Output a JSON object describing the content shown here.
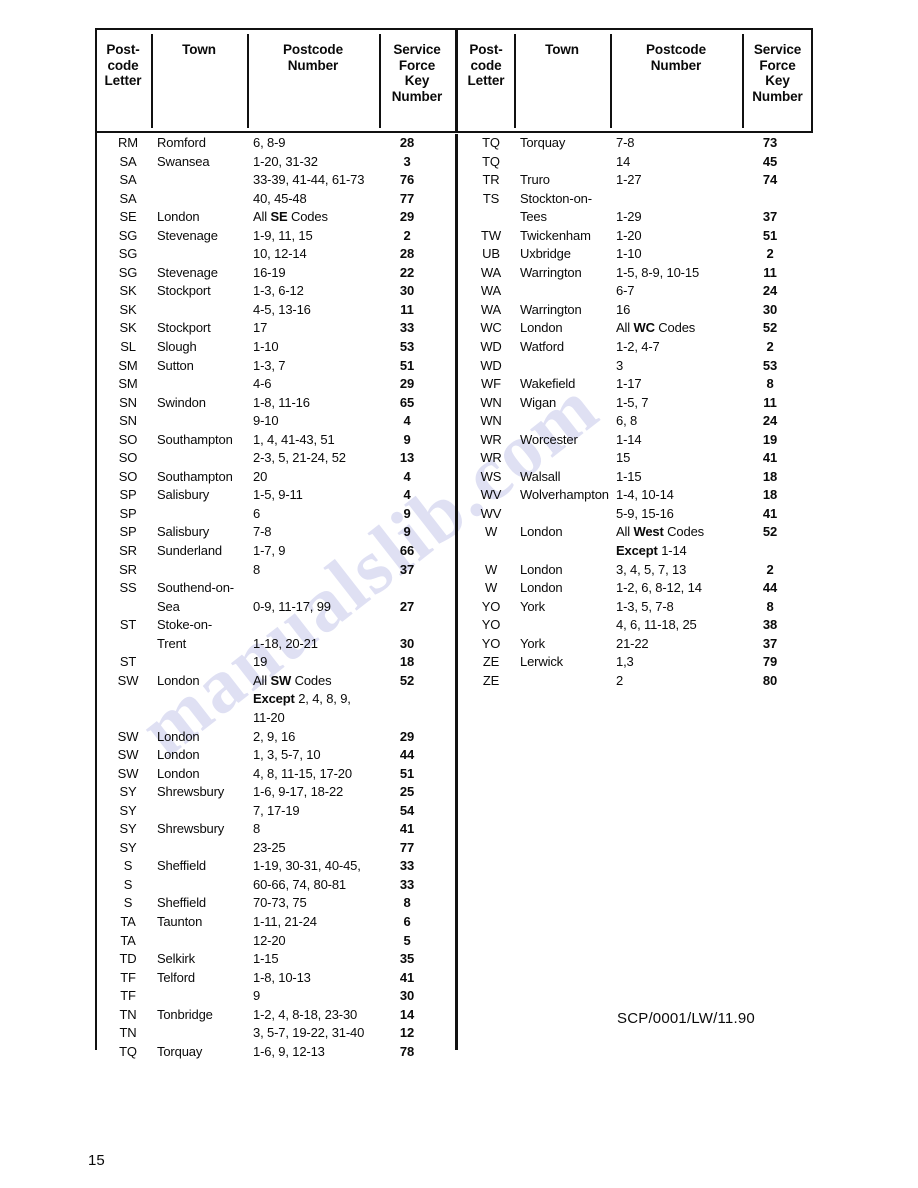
{
  "page": {
    "number": "15",
    "document_reference": "SCP/0001/LW/11.90",
    "watermark": "manualslib.com"
  },
  "table": {
    "headers": {
      "postcode_letter": [
        "Post-",
        "code",
        "Letter"
      ],
      "town": [
        "Town"
      ],
      "postcode_number": [
        "Postcode",
        "Number"
      ],
      "service_force_key_number": [
        "Service",
        "Force",
        "Key",
        "Number"
      ]
    },
    "left_column": [
      {
        "letter": "RM",
        "town": "Romford",
        "code": "6, 8-9",
        "key": "28"
      },
      {
        "letter": "SA",
        "town": "Swansea",
        "code": "1-20, 31-32",
        "key": "3"
      },
      {
        "letter": "SA",
        "town": "",
        "code": "33-39, 41-44, 61-73",
        "key": "76"
      },
      {
        "letter": "SA",
        "town": "",
        "code": "40, 45-48",
        "key": "77"
      },
      {
        "letter": "SE",
        "town": "London",
        "code": "All SE Codes",
        "code_bold": "SE",
        "key": "29"
      },
      {
        "letter": "SG",
        "town": "Stevenage",
        "code": "1-9, 11, 15",
        "key": "2"
      },
      {
        "letter": "SG",
        "town": "",
        "code": "10, 12-14",
        "key": "28"
      },
      {
        "letter": "SG",
        "town": "Stevenage",
        "code": "16-19",
        "key": "22"
      },
      {
        "letter": "SK",
        "town": "Stockport",
        "code": "1-3, 6-12",
        "key": "30"
      },
      {
        "letter": "SK",
        "town": "",
        "code": "4-5, 13-16",
        "key": "11"
      },
      {
        "letter": "SK",
        "town": "Stockport",
        "code": "17",
        "key": "33"
      },
      {
        "letter": "SL",
        "town": "Slough",
        "code": "1-10",
        "key": "53"
      },
      {
        "letter": "SM",
        "town": "Sutton",
        "code": "1-3, 7",
        "key": "51"
      },
      {
        "letter": "SM",
        "town": "",
        "code": "4-6",
        "key": "29"
      },
      {
        "letter": "SN",
        "town": "Swindon",
        "code": "1-8, 11-16",
        "key": "65"
      },
      {
        "letter": "SN",
        "town": "",
        "code": "9-10",
        "key": "4"
      },
      {
        "letter": "SO",
        "town": "Southampton",
        "code": "1, 4, 41-43, 51",
        "key": "9"
      },
      {
        "letter": "SO",
        "town": "",
        "code": "2-3, 5, 21-24, 52",
        "key": "13"
      },
      {
        "letter": "SO",
        "town": "Southampton",
        "code": "20",
        "key": "4"
      },
      {
        "letter": "SP",
        "town": "Salisbury",
        "code": "1-5, 9-11",
        "key": "4"
      },
      {
        "letter": "SP",
        "town": "",
        "code": "6",
        "key": "9"
      },
      {
        "letter": "SP",
        "town": "Salisbury",
        "code": "7-8",
        "key": "9"
      },
      {
        "letter": "SR",
        "town": "Sunderland",
        "code": "1-7, 9",
        "key": "66"
      },
      {
        "letter": "SR",
        "town": "",
        "code": "8",
        "key": "37"
      },
      {
        "letter": "SS",
        "town": "Southend-on-",
        "code": "",
        "key": ""
      },
      {
        "letter": "",
        "town": "Sea",
        "code": "0-9, 11-17, 99",
        "key": "27"
      },
      {
        "letter": "ST",
        "town": "Stoke-on-",
        "code": "",
        "key": ""
      },
      {
        "letter": "",
        "town": "Trent",
        "code": "1-18, 20-21",
        "key": "30"
      },
      {
        "letter": "ST",
        "town": "",
        "code": "19",
        "key": "18"
      },
      {
        "letter": "SW",
        "town": "London",
        "code": "All SW Codes",
        "code_bold": "SW",
        "key": "52"
      },
      {
        "letter": "",
        "town": "",
        "code": "Except 2, 4, 8, 9,",
        "code_bold": "Except",
        "key": ""
      },
      {
        "letter": "",
        "town": "",
        "code": "11-20",
        "key": ""
      },
      {
        "letter": "SW",
        "town": "London",
        "code": "2, 9, 16",
        "key": "29"
      },
      {
        "letter": "SW",
        "town": "London",
        "code": "1, 3, 5-7, 10",
        "key": "44"
      },
      {
        "letter": "SW",
        "town": "London",
        "code": "4, 8, 11-15, 17-20",
        "key": "51"
      },
      {
        "letter": "SY",
        "town": "Shrewsbury",
        "code": "1-6, 9-17, 18-22",
        "key": "25"
      },
      {
        "letter": "SY",
        "town": "",
        "code": "7, 17-19",
        "key": "54"
      },
      {
        "letter": "SY",
        "town": "Shrewsbury",
        "code": "8",
        "key": "41"
      },
      {
        "letter": "SY",
        "town": "",
        "code": "23-25",
        "key": "77"
      },
      {
        "letter": "S",
        "town": "Sheffield",
        "code": "1-19, 30-31, 40-45,",
        "key": "33"
      },
      {
        "letter": "S",
        "town": "",
        "code": "60-66, 74, 80-81",
        "key": "33"
      },
      {
        "letter": "S",
        "town": "Sheffield",
        "code": "70-73, 75",
        "key": "8"
      },
      {
        "letter": "TA",
        "town": "Taunton",
        "code": "1-11, 21-24",
        "key": "6"
      },
      {
        "letter": "TA",
        "town": "",
        "code": "12-20",
        "key": "5"
      },
      {
        "letter": "TD",
        "town": "Selkirk",
        "code": "1-15",
        "key": "35"
      },
      {
        "letter": "TF",
        "town": "Telford",
        "code": "1-8, 10-13",
        "key": "41"
      },
      {
        "letter": "TF",
        "town": "",
        "code": "9",
        "key": "30"
      },
      {
        "letter": "TN",
        "town": "Tonbridge",
        "code": "1-2, 4, 8-18, 23-30",
        "key": "14"
      },
      {
        "letter": "TN",
        "town": "",
        "code": "3, 5-7, 19-22, 31-40",
        "key": "12"
      },
      {
        "letter": "TQ",
        "town": "Torquay",
        "code": "1-6, 9, 12-13",
        "key": "78"
      }
    ],
    "right_column": [
      {
        "letter": "TQ",
        "town": "Torquay",
        "code": "7-8",
        "key": "73"
      },
      {
        "letter": "TQ",
        "town": "",
        "code": "14",
        "key": "45"
      },
      {
        "letter": "TR",
        "town": "Truro",
        "code": "1-27",
        "key": "74"
      },
      {
        "letter": "TS",
        "town": "Stockton-on-",
        "code": "",
        "key": ""
      },
      {
        "letter": "",
        "town": "Tees",
        "code": "1-29",
        "key": "37"
      },
      {
        "letter": "TW",
        "town": "Twickenham",
        "code": "1-20",
        "key": "51"
      },
      {
        "letter": "UB",
        "town": "Uxbridge",
        "code": "1-10",
        "key": "2"
      },
      {
        "letter": "WA",
        "town": "Warrington",
        "code": "1-5, 8-9, 10-15",
        "key": "11"
      },
      {
        "letter": "WA",
        "town": "",
        "code": "6-7",
        "key": "24"
      },
      {
        "letter": "WA",
        "town": "Warrington",
        "code": "16",
        "key": "30"
      },
      {
        "letter": "WC",
        "town": "London",
        "code": "All WC Codes",
        "code_bold": "WC",
        "key": "52"
      },
      {
        "letter": "WD",
        "town": "Watford",
        "code": "1-2, 4-7",
        "key": "2"
      },
      {
        "letter": "WD",
        "town": "",
        "code": "3",
        "key": "53"
      },
      {
        "letter": "WF",
        "town": "Wakefield",
        "code": "1-17",
        "key": "8"
      },
      {
        "letter": "WN",
        "town": "Wigan",
        "code": "1-5, 7",
        "key": "11"
      },
      {
        "letter": "WN",
        "town": "",
        "code": "6, 8",
        "key": "24"
      },
      {
        "letter": "WR",
        "town": "Worcester",
        "code": "1-14",
        "key": "19"
      },
      {
        "letter": "WR",
        "town": "",
        "code": "15",
        "key": "41"
      },
      {
        "letter": "WS",
        "town": "Walsall",
        "code": "1-15",
        "key": "18"
      },
      {
        "letter": "WV",
        "town": "Wolverhampton",
        "code": "1-4, 10-14",
        "key": "18"
      },
      {
        "letter": "WV",
        "town": "",
        "code": "5-9, 15-16",
        "key": "41"
      },
      {
        "letter": "W",
        "town": "London",
        "code": "All West Codes",
        "code_bold": "West",
        "key": "52"
      },
      {
        "letter": "",
        "town": "",
        "code": "Except 1-14",
        "code_bold": "Except",
        "key": ""
      },
      {
        "letter": "W",
        "town": "London",
        "code": "3, 4, 5, 7, 13",
        "key": "2"
      },
      {
        "letter": "W",
        "town": "London",
        "code": "1-2, 6, 8-12, 14",
        "key": "44"
      },
      {
        "letter": "YO",
        "town": "York",
        "code": "1-3, 5, 7-8",
        "key": "8"
      },
      {
        "letter": "YO",
        "town": "",
        "code": "4, 6, 11-18, 25",
        "key": "38"
      },
      {
        "letter": "YO",
        "town": "York",
        "code": "21-22",
        "key": "37"
      },
      {
        "letter": "ZE",
        "town": "Lerwick",
        "code": "1,3",
        "key": "79"
      },
      {
        "letter": "ZE",
        "town": "",
        "code": "2",
        "key": "80"
      }
    ]
  }
}
